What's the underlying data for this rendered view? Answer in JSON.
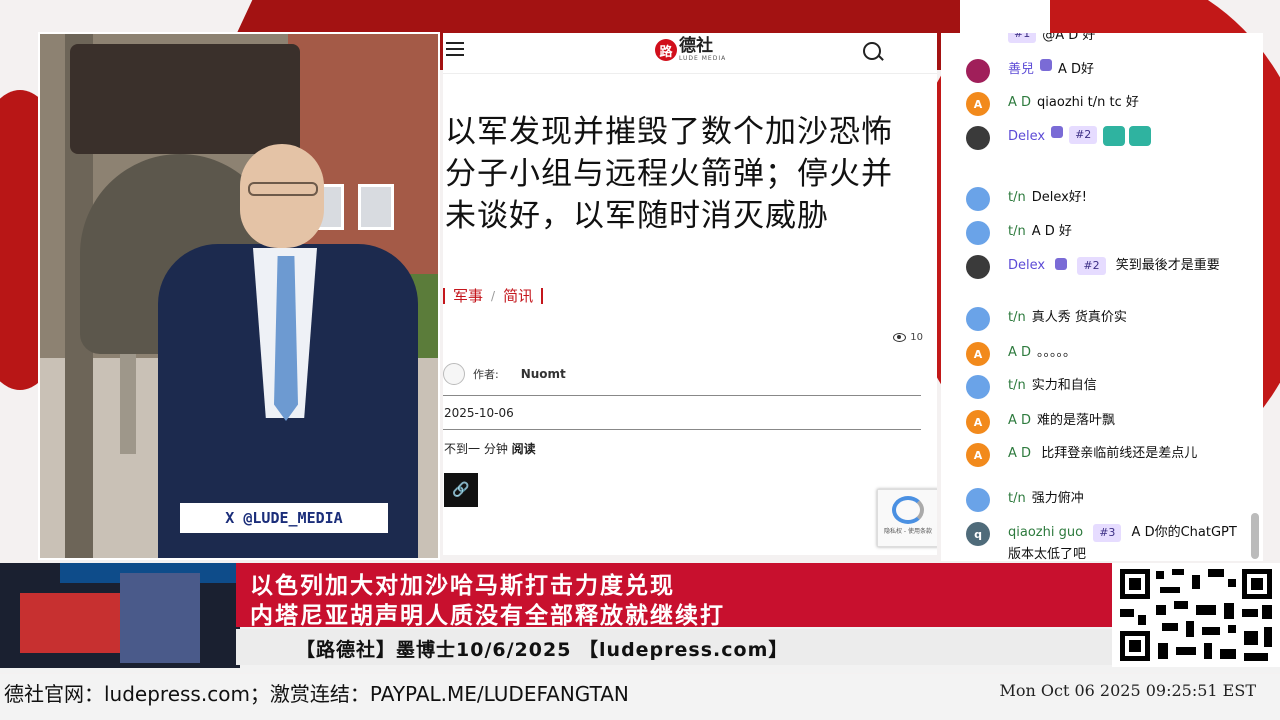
{
  "video": {
    "handle": "X @LUDE_MEDIA"
  },
  "article": {
    "logo": "路德社",
    "logo_sub": "LUDE MEDIA",
    "headline": "以军发现并摧毁了数个加沙恐怖分子小组与远程火箭弹；停火并未谈好，以军随时消灭威胁",
    "categories": [
      "军事",
      "简讯"
    ],
    "views": "10",
    "author_label": "作者:",
    "author": "Nuomt",
    "date": "2025-10-06",
    "read_prefix": "不到一 分钟",
    "read_label": "阅读",
    "recaptcha": "隐私权 - 使用条款"
  },
  "chat": {
    "messages": [
      {
        "avatar": "",
        "name": "",
        "badge": "#1",
        "text": "@A D 好"
      },
      {
        "avatar": "",
        "name": "善兒",
        "badge": "",
        "text": "A D好"
      },
      {
        "avatar": "A",
        "name": "A D",
        "badge": "",
        "text": "qiaozhi t/n tc 好"
      },
      {
        "avatar": "",
        "name": "Delex",
        "badge": "#2",
        "text": ""
      },
      {
        "avatar": "",
        "name": "t/n",
        "badge": "",
        "text": "Delex好!"
      },
      {
        "avatar": "",
        "name": "t/n",
        "badge": "",
        "text": "A D 好"
      },
      {
        "avatar": "",
        "name": "Delex",
        "badge": "#2",
        "text": "笑到最後才是重要"
      },
      {
        "avatar": "",
        "name": "t/n",
        "badge": "",
        "text": "真人秀 货真价实"
      },
      {
        "avatar": "A",
        "name": "A D",
        "badge": "",
        "text": "。。。。。"
      },
      {
        "avatar": "",
        "name": "t/n",
        "badge": "",
        "text": "实力和自信"
      },
      {
        "avatar": "A",
        "name": "A D",
        "badge": "",
        "text": "难的是落叶飘"
      },
      {
        "avatar": "A",
        "name": "A D",
        "badge": "",
        "text": "比拜登亲临前线还是差点儿"
      },
      {
        "avatar": "",
        "name": "t/n",
        "badge": "",
        "text": "强力俯冲"
      },
      {
        "avatar": "q",
        "name": "qiaozhi guo",
        "badge": "#3",
        "text": "A D你的ChatGPT版本太低了吧"
      }
    ]
  },
  "lower_third": {
    "line1": "以色列加大对加沙哈马斯打击力度兑现",
    "line2": "内塔尼亚胡声明人质没有全部释放就继续打",
    "tagline": "【路德社】墨博士10/6/2025 【ludepress.com】"
  },
  "ticker": {
    "text": "德社官网：ludepress.com；激赏连结：PAYPAL.ME/LUDEFANGTAN",
    "clock": "Mon Oct 06 2025 09:25:51 EST"
  },
  "colors": {
    "accent": "#c8102e",
    "chat_name": "#2d7a3d",
    "category": "#c4161c"
  }
}
